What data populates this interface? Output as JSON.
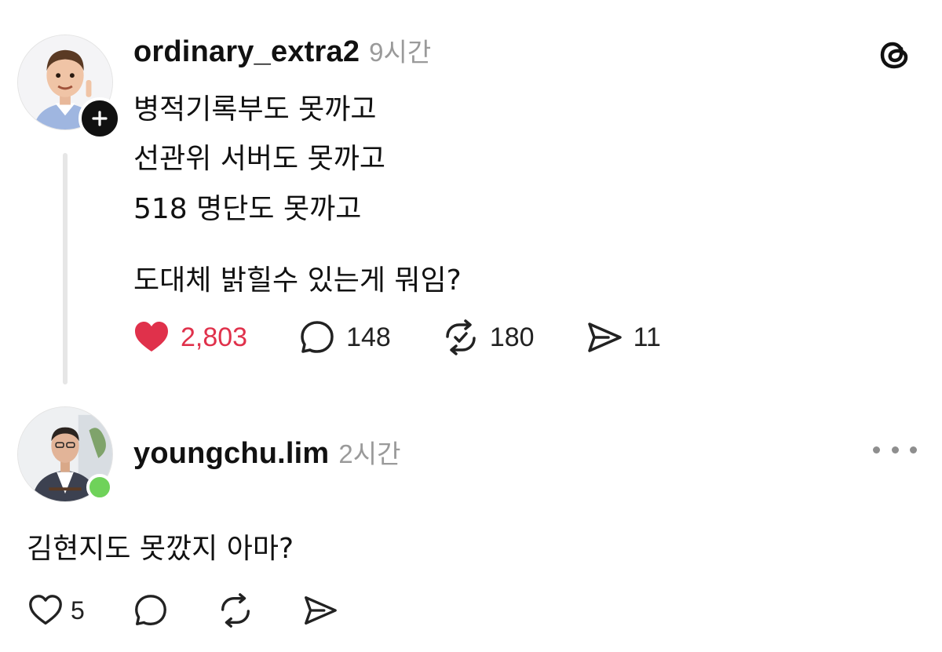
{
  "post": {
    "username": "ordinary_extra2",
    "time": "9시간",
    "lines": [
      "병적기록부도 못까고",
      "선관위 서버도 못까고",
      "518 명단도 못까고",
      "도대체 밝힐수 있는게 뭐임?"
    ],
    "likes": "2,803",
    "comments": "148",
    "reposts": "180",
    "shares": "11",
    "liked": true
  },
  "reply": {
    "username": "youngchu.lim",
    "time": "2시간",
    "text": "김현지도 못깠지 아마?",
    "likes": "5"
  },
  "colors": {
    "liked": "#e0314b",
    "online": "#6fd25a",
    "muted": "#9a9a9a"
  },
  "icons": [
    "threads-logo-icon",
    "plus-icon",
    "heart-icon",
    "comment-icon",
    "repost-icon",
    "share-icon",
    "more-icon"
  ]
}
